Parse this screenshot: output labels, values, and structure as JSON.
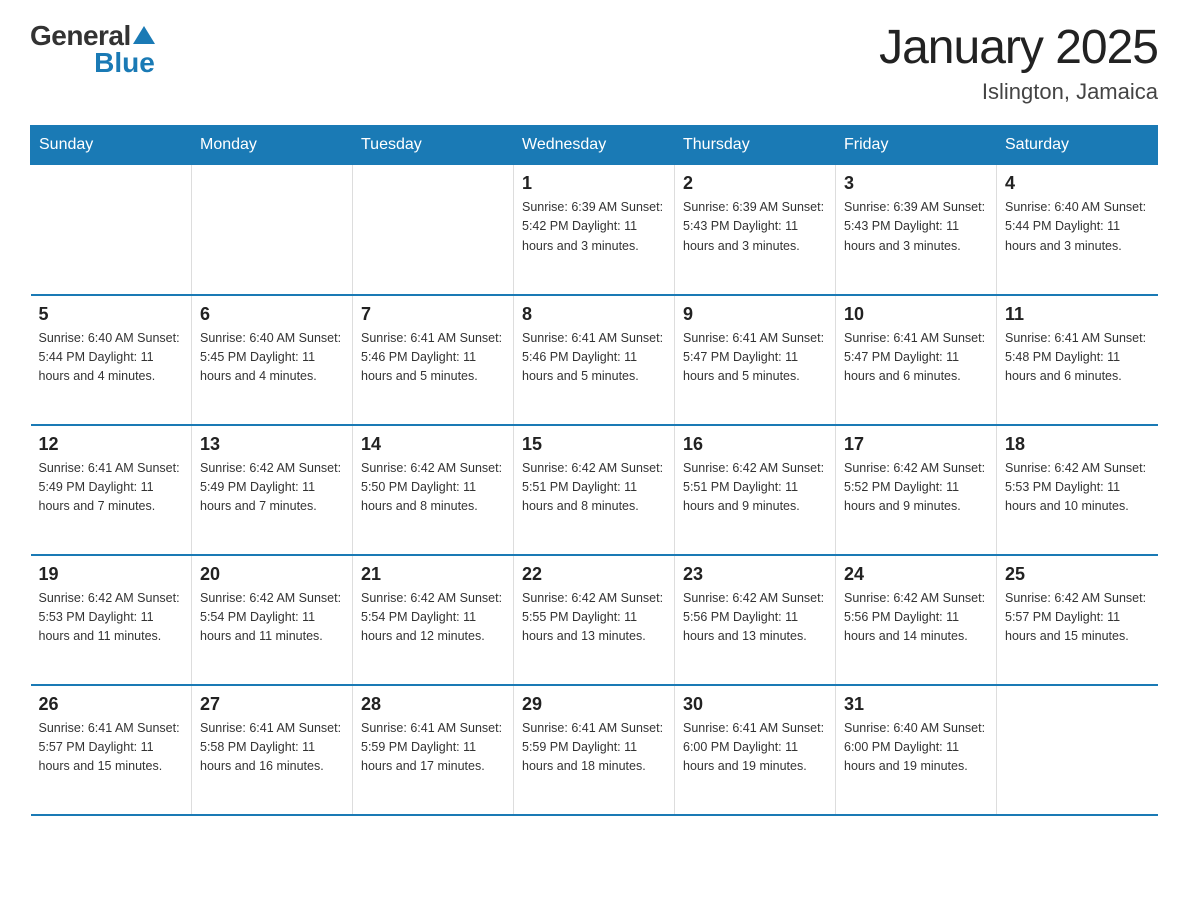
{
  "header": {
    "logo_general": "General",
    "logo_blue": "Blue",
    "title": "January 2025",
    "subtitle": "Islington, Jamaica"
  },
  "weekdays": [
    "Sunday",
    "Monday",
    "Tuesday",
    "Wednesday",
    "Thursday",
    "Friday",
    "Saturday"
  ],
  "weeks": [
    [
      {
        "day": "",
        "info": ""
      },
      {
        "day": "",
        "info": ""
      },
      {
        "day": "",
        "info": ""
      },
      {
        "day": "1",
        "info": "Sunrise: 6:39 AM\nSunset: 5:42 PM\nDaylight: 11 hours and 3 minutes."
      },
      {
        "day": "2",
        "info": "Sunrise: 6:39 AM\nSunset: 5:43 PM\nDaylight: 11 hours and 3 minutes."
      },
      {
        "day": "3",
        "info": "Sunrise: 6:39 AM\nSunset: 5:43 PM\nDaylight: 11 hours and 3 minutes."
      },
      {
        "day": "4",
        "info": "Sunrise: 6:40 AM\nSunset: 5:44 PM\nDaylight: 11 hours and 3 minutes."
      }
    ],
    [
      {
        "day": "5",
        "info": "Sunrise: 6:40 AM\nSunset: 5:44 PM\nDaylight: 11 hours and 4 minutes."
      },
      {
        "day": "6",
        "info": "Sunrise: 6:40 AM\nSunset: 5:45 PM\nDaylight: 11 hours and 4 minutes."
      },
      {
        "day": "7",
        "info": "Sunrise: 6:41 AM\nSunset: 5:46 PM\nDaylight: 11 hours and 5 minutes."
      },
      {
        "day": "8",
        "info": "Sunrise: 6:41 AM\nSunset: 5:46 PM\nDaylight: 11 hours and 5 minutes."
      },
      {
        "day": "9",
        "info": "Sunrise: 6:41 AM\nSunset: 5:47 PM\nDaylight: 11 hours and 5 minutes."
      },
      {
        "day": "10",
        "info": "Sunrise: 6:41 AM\nSunset: 5:47 PM\nDaylight: 11 hours and 6 minutes."
      },
      {
        "day": "11",
        "info": "Sunrise: 6:41 AM\nSunset: 5:48 PM\nDaylight: 11 hours and 6 minutes."
      }
    ],
    [
      {
        "day": "12",
        "info": "Sunrise: 6:41 AM\nSunset: 5:49 PM\nDaylight: 11 hours and 7 minutes."
      },
      {
        "day": "13",
        "info": "Sunrise: 6:42 AM\nSunset: 5:49 PM\nDaylight: 11 hours and 7 minutes."
      },
      {
        "day": "14",
        "info": "Sunrise: 6:42 AM\nSunset: 5:50 PM\nDaylight: 11 hours and 8 minutes."
      },
      {
        "day": "15",
        "info": "Sunrise: 6:42 AM\nSunset: 5:51 PM\nDaylight: 11 hours and 8 minutes."
      },
      {
        "day": "16",
        "info": "Sunrise: 6:42 AM\nSunset: 5:51 PM\nDaylight: 11 hours and 9 minutes."
      },
      {
        "day": "17",
        "info": "Sunrise: 6:42 AM\nSunset: 5:52 PM\nDaylight: 11 hours and 9 minutes."
      },
      {
        "day": "18",
        "info": "Sunrise: 6:42 AM\nSunset: 5:53 PM\nDaylight: 11 hours and 10 minutes."
      }
    ],
    [
      {
        "day": "19",
        "info": "Sunrise: 6:42 AM\nSunset: 5:53 PM\nDaylight: 11 hours and 11 minutes."
      },
      {
        "day": "20",
        "info": "Sunrise: 6:42 AM\nSunset: 5:54 PM\nDaylight: 11 hours and 11 minutes."
      },
      {
        "day": "21",
        "info": "Sunrise: 6:42 AM\nSunset: 5:54 PM\nDaylight: 11 hours and 12 minutes."
      },
      {
        "day": "22",
        "info": "Sunrise: 6:42 AM\nSunset: 5:55 PM\nDaylight: 11 hours and 13 minutes."
      },
      {
        "day": "23",
        "info": "Sunrise: 6:42 AM\nSunset: 5:56 PM\nDaylight: 11 hours and 13 minutes."
      },
      {
        "day": "24",
        "info": "Sunrise: 6:42 AM\nSunset: 5:56 PM\nDaylight: 11 hours and 14 minutes."
      },
      {
        "day": "25",
        "info": "Sunrise: 6:42 AM\nSunset: 5:57 PM\nDaylight: 11 hours and 15 minutes."
      }
    ],
    [
      {
        "day": "26",
        "info": "Sunrise: 6:41 AM\nSunset: 5:57 PM\nDaylight: 11 hours and 15 minutes."
      },
      {
        "day": "27",
        "info": "Sunrise: 6:41 AM\nSunset: 5:58 PM\nDaylight: 11 hours and 16 minutes."
      },
      {
        "day": "28",
        "info": "Sunrise: 6:41 AM\nSunset: 5:59 PM\nDaylight: 11 hours and 17 minutes."
      },
      {
        "day": "29",
        "info": "Sunrise: 6:41 AM\nSunset: 5:59 PM\nDaylight: 11 hours and 18 minutes."
      },
      {
        "day": "30",
        "info": "Sunrise: 6:41 AM\nSunset: 6:00 PM\nDaylight: 11 hours and 19 minutes."
      },
      {
        "day": "31",
        "info": "Sunrise: 6:40 AM\nSunset: 6:00 PM\nDaylight: 11 hours and 19 minutes."
      },
      {
        "day": "",
        "info": ""
      }
    ]
  ]
}
